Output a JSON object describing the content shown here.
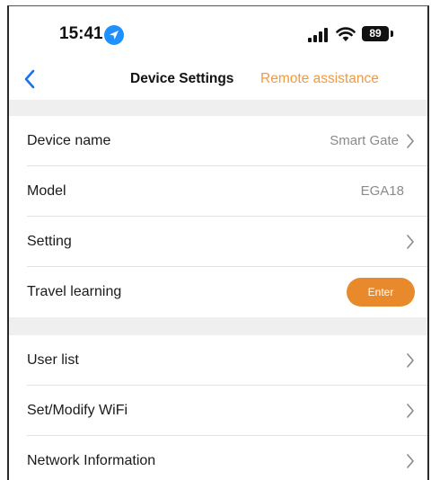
{
  "status_bar": {
    "time": "15:41",
    "battery": "89"
  },
  "nav": {
    "title": "Device Settings",
    "action_label": "Remote assistance"
  },
  "rows": [
    {
      "label": "Device name",
      "value": "Smart Gate"
    },
    {
      "label": "Model",
      "value": "EGA18"
    },
    {
      "label": "Setting"
    },
    {
      "label": "Travel learning",
      "button_label": "Enter"
    },
    {
      "label": "User list"
    },
    {
      "label": "Set/Modify WiFi"
    },
    {
      "label": "Network Information"
    }
  ],
  "colors": {
    "accent": "#f29a3c",
    "button_bg": "#e88a2c",
    "section_gap": "#efefef",
    "location_icon": "#1e90ff"
  }
}
